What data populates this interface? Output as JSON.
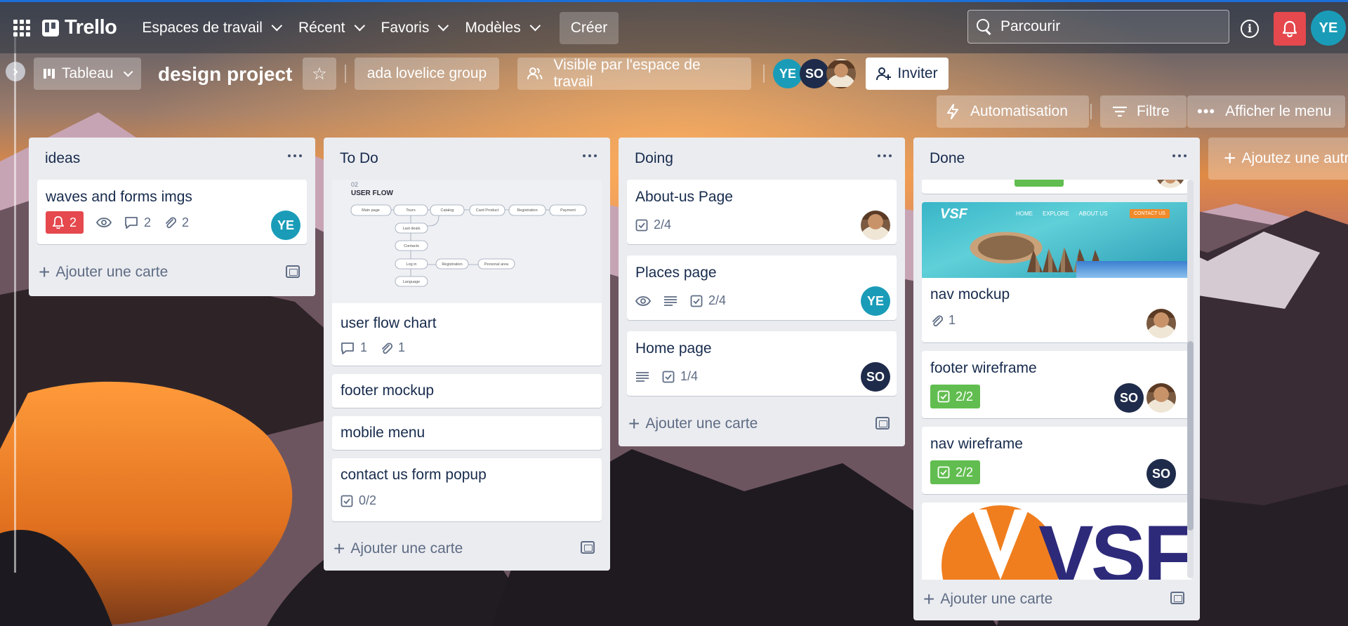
{
  "topbar": {
    "logo": "Trello",
    "nav": [
      "Espaces de travail",
      "Récent",
      "Favoris",
      "Modèles"
    ],
    "create": "Créer",
    "search_placeholder": "Parcourir",
    "user_initials": "YE"
  },
  "board": {
    "view": "Tableau",
    "title": "design project",
    "workspace": "ada lovelice group",
    "visibility": "Visible par l'espace de travail",
    "invite": "Inviter",
    "members": [
      "YE",
      "SO"
    ],
    "automation": "Automatisation",
    "filter": "Filtre",
    "menu": "Afficher le menu",
    "add_list": "Ajoutez une autre liste"
  },
  "add_card_label": "Ajouter une carte",
  "lists": [
    {
      "title": "ideas",
      "cards": [
        {
          "title": "waves and forms imgs",
          "notifications": "2",
          "comments": "2",
          "attachments": "2",
          "member": "YE"
        }
      ]
    },
    {
      "title": "To Do",
      "cover": {
        "number": "02",
        "heading": "USER FLOW",
        "nodes": [
          "Main page",
          "Tours",
          "Catalog",
          "Card Product",
          "Registration",
          "Payment",
          "Last deals",
          "Contacts",
          "Log in",
          "Registration",
          "Personal area",
          "Language"
        ]
      },
      "cards": [
        {
          "title": "user flow chart",
          "comments": "1",
          "attachments": "1"
        },
        {
          "title": "footer mockup"
        },
        {
          "title": "mobile menu"
        },
        {
          "title": "contact us form popup",
          "checklist": "0/2"
        }
      ]
    },
    {
      "title": "Doing",
      "cards": [
        {
          "title": "About-us Page",
          "checklist": "2/4"
        },
        {
          "title": "Places page",
          "checklist": "2/4",
          "member": "YE"
        },
        {
          "title": "Home page",
          "checklist": "1/4",
          "member": "SO"
        }
      ]
    },
    {
      "title": "Done",
      "cards": [
        {
          "title": "nav mockup",
          "attachments": "1",
          "cover_logo": "VSF",
          "cover_menu": [
            "HOME",
            "EXPLORE",
            "ABOUT US"
          ],
          "cover_cta": "CONTACT US"
        },
        {
          "title": "footer wireframe",
          "checklist": "2/2",
          "member": "SO"
        },
        {
          "title": "nav wireframe",
          "checklist": "2/2",
          "member": "SO"
        },
        {
          "cover_logo": "VSF"
        }
      ]
    }
  ],
  "colors": {
    "list_bg": "#ebecf0",
    "alert": "#e5484d",
    "complete": "#61bd4f",
    "ye_avatar": "#1a9cb8",
    "so_avatar": "#1f2b4a"
  }
}
